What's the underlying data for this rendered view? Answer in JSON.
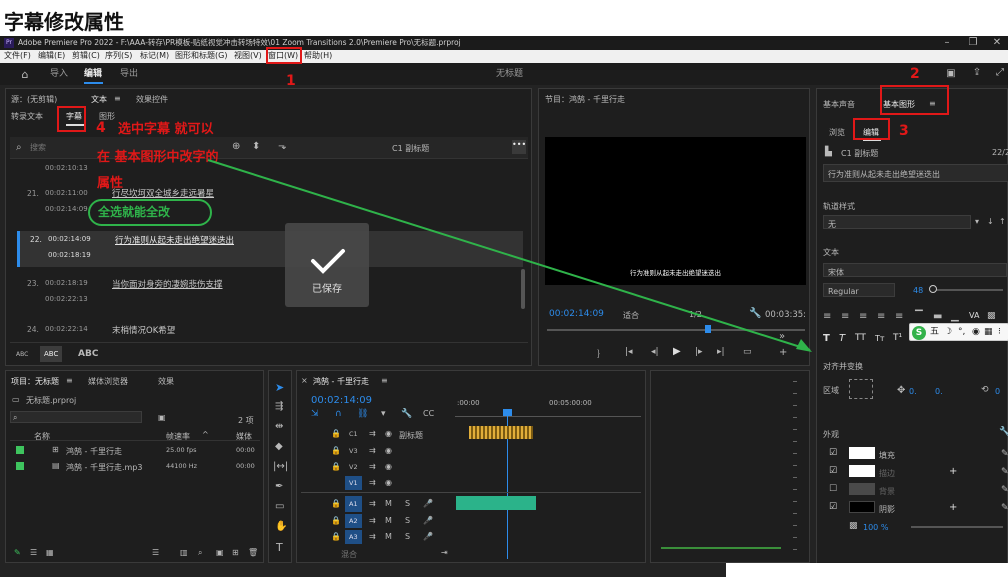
{
  "page_heading": "字幕修改属性",
  "titlebar": {
    "title": "Adobe Premiere Pro 2022 - F:\\AAA-转存\\PR模板-贴纸视觉冲击转场特效\\01 Zoom Transitions 2.0\\Premiere Pro\\无标题.prproj",
    "logo": "Pr"
  },
  "menubar": [
    "文件(F)",
    "编辑(E)",
    "剪辑(C)",
    "序列(S)",
    "标记(M)",
    "图形和标题(G)",
    "视图(V)",
    "窗口(W)",
    "帮助(H)"
  ],
  "workspace_bar": {
    "tabs": [
      "导入",
      "编辑",
      "导出"
    ],
    "active": "编辑",
    "doc_title": "无标题"
  },
  "text_panel": {
    "top_tabs": [
      "源：(无剪辑)",
      "文本",
      "效果控件"
    ],
    "sub_tabs": [
      "转录文本",
      "字幕",
      "图形"
    ],
    "search_placeholder": "搜索",
    "track_label": "C1 副标题",
    "captions": [
      {
        "num": "",
        "in": "00:02:10:13",
        "out": "",
        "text": ""
      },
      {
        "num": "21.",
        "in": "00:02:11:00",
        "out": "00:02:14:09",
        "text": "行尽坎坷双全城乡走远暑星"
      },
      {
        "num": "22.",
        "in": "00:02:14:09",
        "out": "00:02:18:19",
        "text": "行为准则从起未走出绝望迷迭出"
      },
      {
        "num": "23.",
        "in": "00:02:18:19",
        "out": "00:02:22:13",
        "text": "当你面对身旁的凄婉悲伤支撑"
      },
      {
        "num": "24.",
        "in": "00:02:22:14",
        "out": "",
        "text": "末梢情况OK希望"
      }
    ],
    "footer": [
      "ABC",
      "ABC",
      "ABC"
    ]
  },
  "saved_toast": "已保存",
  "program_monitor": {
    "title": "节目：鸿鹄 - 千里行走",
    "subtitle_overlay": "行为准则从起未走出绝望迷迭出",
    "timecode": "00:02:14:09",
    "fit": "适合",
    "quality": "1/2",
    "duration": "00:03:35:"
  },
  "essential_graphics": {
    "tabs": [
      "基本声音",
      "基本图形"
    ],
    "sub_tabs": [
      "浏览",
      "编辑"
    ],
    "layer": "C1 副标题",
    "layer_count": "22/2",
    "caption_text": "行为准则从起未走出绝望迷迭出",
    "track_style_label": "轨道样式",
    "track_style_value": "无",
    "text_label": "文本",
    "font": "宋体",
    "font_style": "Regular",
    "font_size": "48",
    "align_label": "对齐并变换",
    "region_label": "区域",
    "position_values": [
      "0.",
      "0."
    ],
    "rotation_value": "0",
    "appearance_label": "外观",
    "appearance_items": [
      {
        "label": "填充",
        "checked": true,
        "color": "#ffffff"
      },
      {
        "label": "描边",
        "checked": true,
        "color": "#ffffff"
      },
      {
        "label": "背景",
        "checked": false,
        "color": "#4a4a4a"
      },
      {
        "label": "阴影",
        "checked": true,
        "color": "#000000"
      }
    ],
    "opacity_value": "100 %"
  },
  "project_panel": {
    "tabs": [
      "项目：无标题",
      "媒体浏览器",
      "效果"
    ],
    "file": "无标题.prproj",
    "item_count": "2 项",
    "columns": [
      "名称",
      "帧速率",
      "媒体"
    ],
    "items": [
      {
        "name": "鸿鹄 - 千里行走",
        "rate": "25.00 fps",
        "media": "00:00",
        "color": "#3ec45e"
      },
      {
        "name": "鸿鹄 - 千里行走.mp3",
        "rate": "44100 Hz",
        "media": "00:00",
        "color": "#3ec45e"
      }
    ]
  },
  "timeline": {
    "title": "鸿鹄 - 千里行走",
    "timecode": "00:02:14:09",
    "ruler": [
      ":00:00",
      "00:05:00:00"
    ],
    "tracks": [
      "C1",
      "V3",
      "V2",
      "V1",
      "A1",
      "A2",
      "A3"
    ],
    "c1_label": "副标题",
    "master": "混合"
  },
  "ime": "五",
  "annotations": {
    "n1": "1",
    "n2": "2",
    "n3": "3",
    "n4": "4",
    "line1": "选中字幕 就可以",
    "line2": "在 基本图形中改字的",
    "line3": "属性",
    "line4": "全选就能全改"
  }
}
